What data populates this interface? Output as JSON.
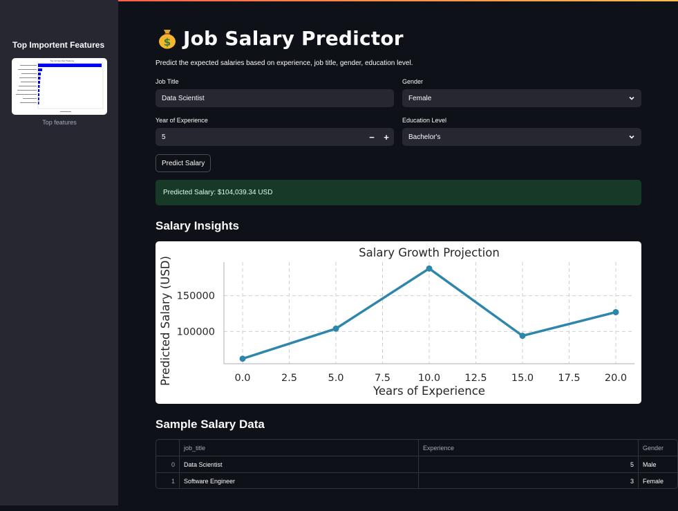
{
  "sidebar": {
    "title": "Top Importent Features",
    "image_caption": "Top features",
    "thumbnail_title": "Top 10 Important Features"
  },
  "header": {
    "icon": "money-bag-icon",
    "title": "Job Salary Predictor",
    "subtitle": "Predict the expected salaries based on experience, job title, gender, education level."
  },
  "form": {
    "job_title_label": "Job Title",
    "job_title_value": "Data Scientist",
    "gender_label": "Gender",
    "gender_value": "Female",
    "experience_label": "Year of Experience",
    "experience_value": "5",
    "stepper_minus": "−",
    "stepper_plus": "+",
    "education_label": "Education Level",
    "education_value": "Bachelor's",
    "predict_button": "Predict Salary"
  },
  "result": {
    "text": "Predicted Salary: $104,039.34 USD"
  },
  "insights": {
    "heading": "Salary Insights"
  },
  "chart_data": {
    "type": "line",
    "title": "Salary Growth Projection",
    "xlabel": "Years of Experience",
    "ylabel": "Predicted Salary (USD)",
    "x": [
      0,
      5,
      10,
      15,
      20
    ],
    "values": [
      62000,
      104000,
      188000,
      94000,
      127000
    ],
    "xlim": [
      -1,
      21
    ],
    "ylim": [
      55000,
      197000
    ],
    "xticks": [
      "0.0",
      "2.5",
      "5.0",
      "7.5",
      "10.0",
      "12.5",
      "15.0",
      "17.5",
      "20.0"
    ],
    "xtick_values": [
      0,
      2.5,
      5,
      7.5,
      10,
      12.5,
      15,
      17.5,
      20
    ],
    "yticks": [
      "100000",
      "150000"
    ],
    "ytick_values": [
      100000,
      150000
    ],
    "grid": true,
    "line_color": "#2e86ab"
  },
  "table": {
    "heading": "Sample Salary Data",
    "columns": [
      "",
      "job_title",
      "Experience",
      "Gender"
    ],
    "rows": [
      {
        "index": "0",
        "job_title": "Data Scientist",
        "experience": "5",
        "gender": "Male"
      },
      {
        "index": "1",
        "job_title": "Software Engineer",
        "experience": "3",
        "gender": "Female"
      }
    ]
  }
}
